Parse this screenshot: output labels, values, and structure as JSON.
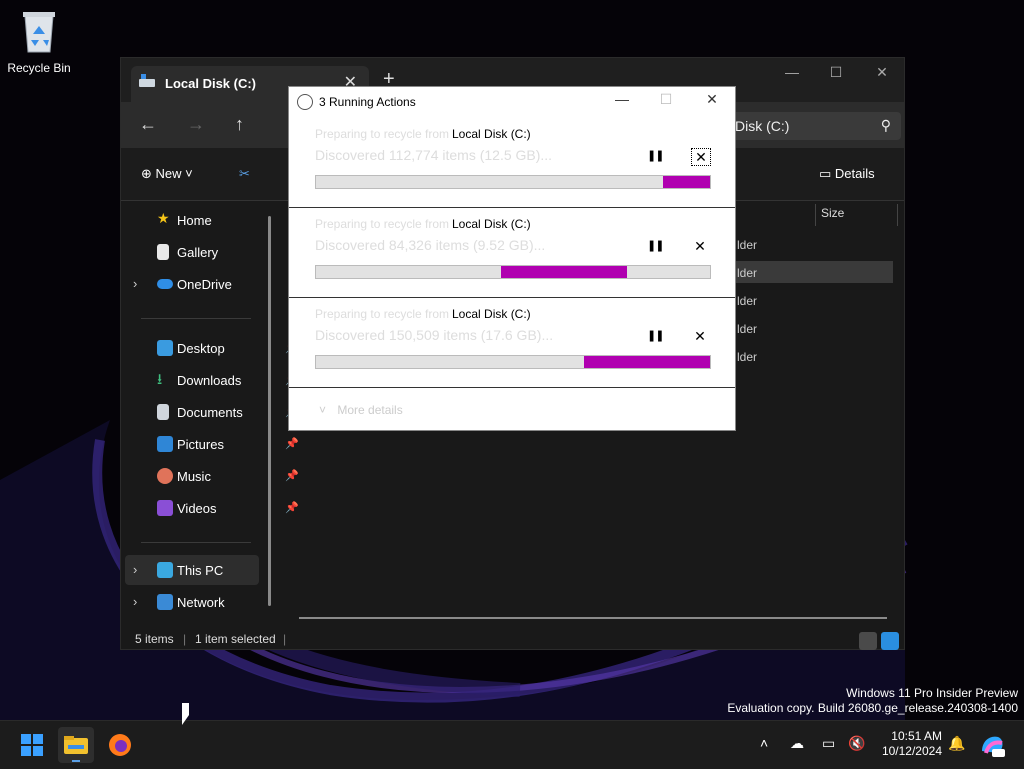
{
  "desktop": {
    "recycle_bin_label": "Recycle Bin",
    "watermark_line1": "Windows 11 Pro Insider Preview",
    "watermark_line2": "Evaluation copy. Build 26080.ge_release.240308-1400"
  },
  "explorer": {
    "tab_title": "Local Disk (C:)",
    "new_tab_label": "+",
    "address_tail": "Disk (C:)",
    "command_bar": {
      "new_label": "New",
      "details_label": "Details"
    },
    "sidebar": {
      "home": "Home",
      "gallery": "Gallery",
      "onedrive": "OneDrive",
      "desktop": "Desktop",
      "downloads": "Downloads",
      "documents": "Documents",
      "pictures": "Pictures",
      "music": "Music",
      "videos": "Videos",
      "this_pc": "This PC",
      "network": "Network"
    },
    "column_size": "Size",
    "row_fragments": [
      "lder",
      "lder",
      "lder",
      "lder",
      "lder"
    ],
    "status": {
      "items": "5 items",
      "selected": "1 item selected"
    }
  },
  "dialog": {
    "title": "3 Running Actions",
    "more_details": "More details",
    "actions": [
      {
        "line1": "Preparing to recycle from",
        "target": "Local Disk (C:)",
        "line2": "Discovered 112,774 items (12.5 GB)...",
        "progress_start": 0.88,
        "progress_end": 1.0
      },
      {
        "line1": "Preparing to recycle from",
        "target": "Local Disk (C:)",
        "line2": "Discovered 84,326 items (9.52 GB)...",
        "progress_start": 0.47,
        "progress_end": 0.79
      },
      {
        "line1": "Preparing to recycle from",
        "target": "Local Disk (C:)",
        "line2": "Discovered 150,509 items (17.6 GB)...",
        "progress_start": 0.68,
        "progress_end": 1.0
      }
    ],
    "progress_color": "#b000b0"
  },
  "taskbar": {
    "time": "10:51 AM",
    "date": "10/12/2024",
    "apps": [
      "start-icon",
      "file-explorer-icon",
      "firefox-icon"
    ]
  }
}
